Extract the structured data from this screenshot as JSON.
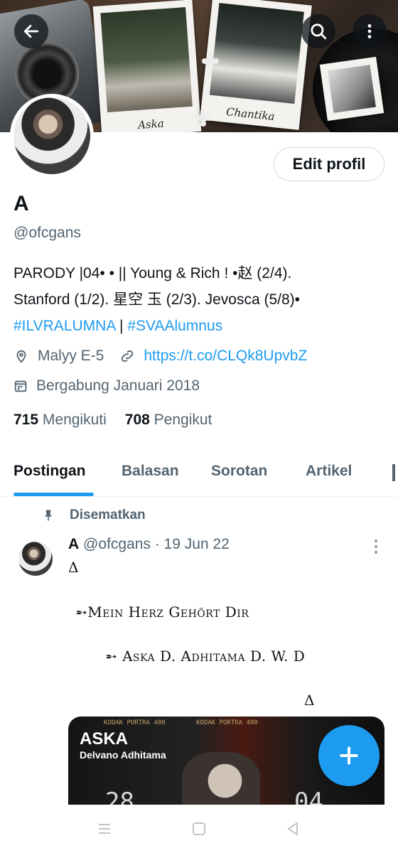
{
  "banner": {
    "caption_left": "Aska",
    "caption_right": "Chantika",
    "colors": {
      "overlay_button": "#0f1419"
    }
  },
  "header": {
    "back_icon": "arrow-left-icon",
    "search_icon": "search-icon",
    "more_icon": "more-vertical-icon"
  },
  "profile": {
    "edit_button": "Edit profil",
    "name": "A",
    "handle": "@ofcgans",
    "bio_line1": "PARODY |04•  • || Young & Rich ! •赵 (2/4).",
    "bio_line2": "Stanford (1/2). 星空 玉 (2/3). Jevosca (5/8)•",
    "hashtag1": "#ILVRALUMNA",
    "hashtag_sep": " | ",
    "hashtag2": "#SVAAlumnus",
    "location": "Malyy E-5",
    "url": "https://t.co/CLQk8UpvbZ",
    "joined": "Bergabung Januari 2018",
    "following_count": "715",
    "following_label": "Mengikuti",
    "followers_count": "708",
    "followers_label": "Pengikut"
  },
  "tabs": [
    {
      "label": "Postingan",
      "active": true
    },
    {
      "label": "Balasan",
      "active": false
    },
    {
      "label": "Sorotan",
      "active": false
    },
    {
      "label": "Artikel",
      "active": false
    }
  ],
  "post": {
    "pinned_label": "Disematkan",
    "author": "A",
    "handle_date": "@ofcgans · 19 Jun 22",
    "line1": "Δ",
    "line2": "➵Mein Herz Gehört Dir",
    "line3": "➵ Aska D. Adhitama D. W. D",
    "line4": "Δ",
    "media": {
      "film_text": "KODAK PORTRA 400",
      "title": "ASKA",
      "subtitle": "Delvano Adhitama",
      "num_left": "28",
      "num_right": "04"
    }
  },
  "colors": {
    "accent": "#1d9bf0",
    "text": "#0f1419",
    "secondary": "#536471"
  }
}
